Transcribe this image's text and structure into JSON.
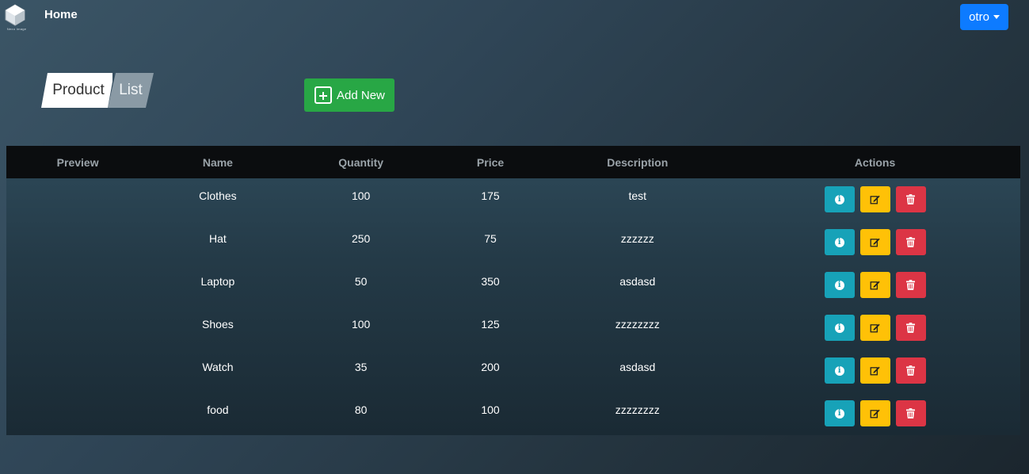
{
  "nav": {
    "home": "Home",
    "logo_text": "Nexo Image",
    "user_menu": "otro"
  },
  "page": {
    "title_part1": "Product",
    "title_part2": "List",
    "add_button": "Add New"
  },
  "table": {
    "headers": [
      "Preview",
      "Name",
      "Quantity",
      "Price",
      "Description",
      "Actions"
    ],
    "rows": [
      {
        "name": "Clothes",
        "quantity": "100",
        "price": "175",
        "description": "test"
      },
      {
        "name": "Hat",
        "quantity": "250",
        "price": "75",
        "description": "zzzzzz"
      },
      {
        "name": "Laptop",
        "quantity": "50",
        "price": "350",
        "description": "asdasd"
      },
      {
        "name": "Shoes",
        "quantity": "100",
        "price": "125",
        "description": "zzzzzzzz"
      },
      {
        "name": "Watch",
        "quantity": "35",
        "price": "200",
        "description": "asdasd"
      },
      {
        "name": "food",
        "quantity": "80",
        "price": "100",
        "description": "zzzzzzzz"
      }
    ]
  },
  "colors": {
    "info": "#17a2b8",
    "edit": "#ffc107",
    "delete": "#dc3545",
    "add": "#28a745",
    "primary": "#0d7bff"
  }
}
